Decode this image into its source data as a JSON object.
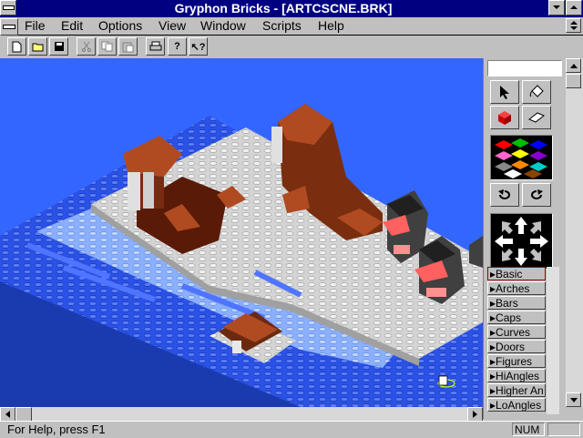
{
  "window": {
    "title": "Gryphon Bricks  - [ARTCSCNE.BRK]"
  },
  "menu": [
    "File",
    "Edit",
    "Options",
    "View",
    "Window",
    "Scripts",
    "Help"
  ],
  "toolbar": {
    "buttons": [
      "new-file-icon",
      "open-folder-icon",
      "save-disk-icon",
      "cut-icon",
      "copy-icon",
      "paste-icon",
      "print-icon",
      "help-icon",
      "context-help-icon"
    ]
  },
  "palette": {
    "tools": [
      "select-arrow-icon",
      "paint-bucket-icon",
      "red-brick-icon",
      "eraser-icon",
      "rotate-left-icon",
      "rotate-right-icon"
    ],
    "colors": [
      "#ff0000",
      "#ffff00",
      "#00c000",
      "#0000ff",
      "#ffffff",
      "#ff66cc",
      "#00cccc",
      "#ff8800",
      "#8800cc",
      "#ffffff",
      "#ff0000",
      "#0000aa",
      "#888888",
      "#000000",
      "#884400"
    ]
  },
  "categories": [
    "Basic",
    "Arches",
    "Bars",
    "Caps",
    "Curves",
    "Doors",
    "Figures",
    "HiAngles",
    "Higher An",
    "LoAngles"
  ],
  "status": {
    "help": "For Help, press F1",
    "num": "NUM"
  }
}
